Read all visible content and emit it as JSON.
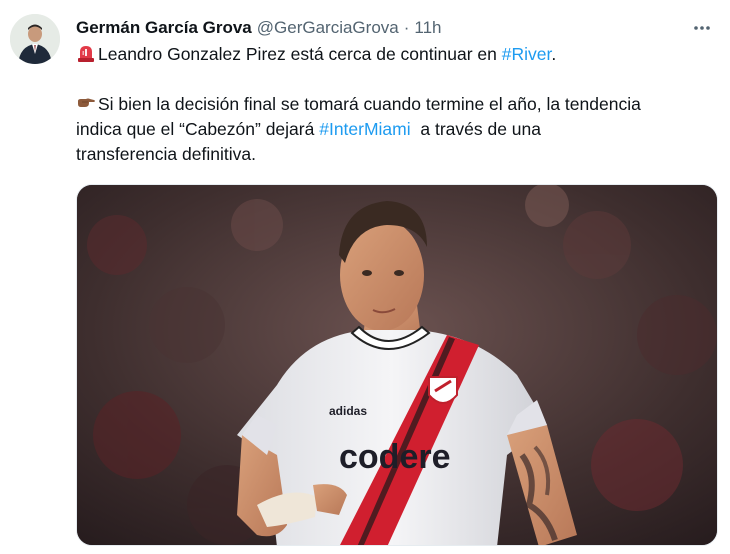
{
  "author": {
    "name": "Germán García Grova",
    "handle": "@GerGarciaGrova",
    "separator": "·",
    "time": "11h"
  },
  "tweet": {
    "line1": {
      "emoji": "rotating-light-icon",
      "text": "Leandro Gonzalez Pirez está cerca de continuar en ",
      "hashtag": "#River",
      "suffix": "."
    },
    "line2": {
      "emoji": "pointing-right-icon",
      "text": "Si bien la decisión final se tomará cuando termine el año, la tendencia"
    },
    "line3": {
      "prefix": "indica que el “Cabezón” dejará ",
      "hashtag": "#InterMiami",
      "suffix": "  a través de una"
    },
    "line4": {
      "text": "transferencia definitiva."
    }
  },
  "media": {
    "jersey_text": "codere",
    "sponsor": "adidas",
    "icon": "soccer-player-photo"
  },
  "colors": {
    "hashtag": "#1d9bf0",
    "secondary": "#536471",
    "primary": "#0f1419",
    "sash": "#d01f2f"
  },
  "icons": {
    "more": "more-horizontal-icon"
  }
}
